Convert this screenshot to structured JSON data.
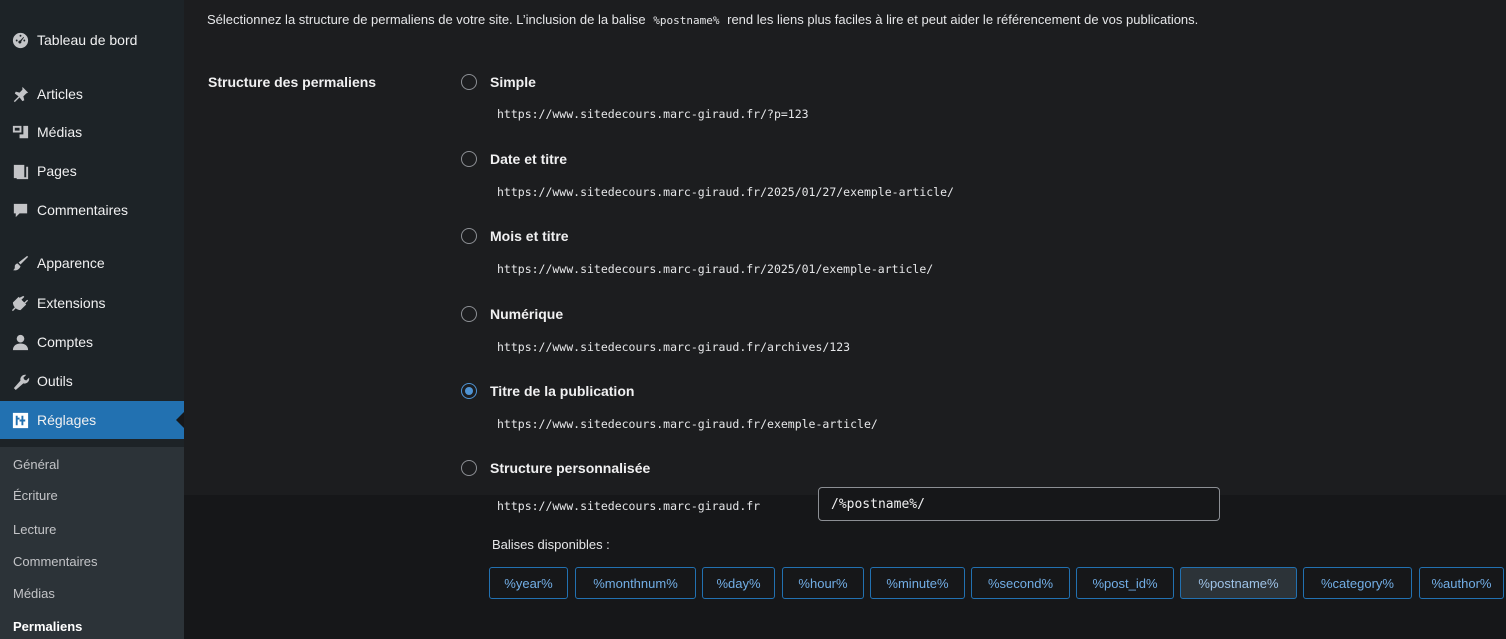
{
  "sidebar": {
    "items": [
      {
        "label": "Tableau de bord",
        "icon": "dashboard-icon"
      },
      {
        "label": "Articles",
        "icon": "pin-icon"
      },
      {
        "label": "Médias",
        "icon": "media-icon"
      },
      {
        "label": "Pages",
        "icon": "pages-icon"
      },
      {
        "label": "Commentaires",
        "icon": "comment-icon"
      },
      {
        "label": "Apparence",
        "icon": "brush-icon"
      },
      {
        "label": "Extensions",
        "icon": "plugin-icon"
      },
      {
        "label": "Comptes",
        "icon": "users-icon"
      },
      {
        "label": "Outils",
        "icon": "wrench-icon"
      },
      {
        "label": "Réglages",
        "icon": "settings-icon",
        "active": true
      }
    ],
    "submenu": [
      "Général",
      "Écriture",
      "Lecture",
      "Commentaires",
      "Médias",
      "Permaliens"
    ],
    "current_submenu": "Permaliens"
  },
  "intro": {
    "before": "Sélectionnez la structure de permaliens de votre site. L’inclusion de la balise",
    "tag": "%postname%",
    "after": "rend les liens plus faciles à lire et peut aider le référencement de vos publications."
  },
  "field_label": "Structure des permaliens",
  "options": [
    {
      "label": "Simple",
      "url": "https://www.sitedecours.marc-giraud.fr/?p=123",
      "checked": false
    },
    {
      "label": "Date et titre",
      "url": "https://www.sitedecours.marc-giraud.fr/2025/01/27/exemple-article/",
      "checked": false
    },
    {
      "label": "Mois et titre",
      "url": "https://www.sitedecours.marc-giraud.fr/2025/01/exemple-article/",
      "checked": false
    },
    {
      "label": "Numérique",
      "url": "https://www.sitedecours.marc-giraud.fr/archives/123",
      "checked": false
    },
    {
      "label": "Titre de la publication",
      "url": "https://www.sitedecours.marc-giraud.fr/exemple-article/",
      "checked": true
    },
    {
      "label": "Structure personnalisée",
      "url": "https://www.sitedecours.marc-giraud.fr",
      "checked": false
    }
  ],
  "custom": {
    "value": "/%postname%/"
  },
  "tags_label": "Balises disponibles :",
  "tags": [
    "%year%",
    "%monthnum%",
    "%day%",
    "%hour%",
    "%minute%",
    "%second%",
    "%post_id%",
    "%postname%",
    "%category%",
    "%author%"
  ],
  "pressed_tag": "%postname%",
  "colors": {
    "accent": "#2271b1",
    "sidebar": "#1d2327",
    "link": "#72aee6"
  }
}
